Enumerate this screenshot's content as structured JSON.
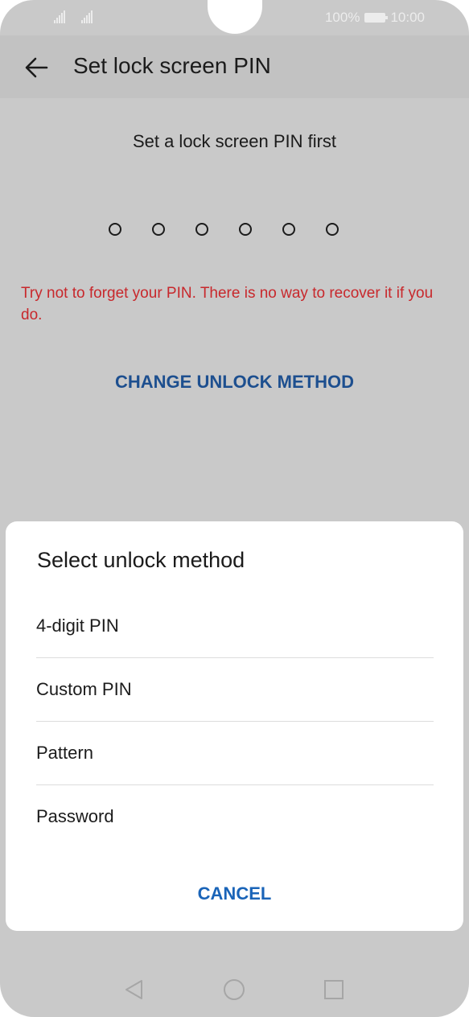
{
  "status_bar": {
    "battery_percent": "100%",
    "time": "10:00",
    "icons": [
      "signal-icon",
      "signal-icon",
      "battery-icon"
    ]
  },
  "app_bar": {
    "back_icon": "arrow-left-icon",
    "title": "Set lock screen PIN"
  },
  "main": {
    "heading": "Set a lock screen PIN first",
    "pin_length": 6,
    "warning": "Try not to forget your PIN. There is no way to recover it if you do.",
    "change_method_label": "CHANGE UNLOCK METHOD"
  },
  "dialog": {
    "title": "Select unlock method",
    "options": [
      {
        "label": "4-digit PIN"
      },
      {
        "label": "Custom PIN"
      },
      {
        "label": "Pattern"
      },
      {
        "label": "Password"
      }
    ],
    "cancel_label": "CANCEL"
  },
  "nav_bar": {
    "icons": [
      "back-triangle-icon",
      "home-circle-icon",
      "recents-square-icon"
    ]
  },
  "colors": {
    "background_dim": "#c9c9c9",
    "app_bar": "#c2c2c2",
    "warning": "#c8282c",
    "link_dimmed": "#1d4f8f",
    "accent": "#1a64b8",
    "dialog_bg": "#ffffff"
  }
}
